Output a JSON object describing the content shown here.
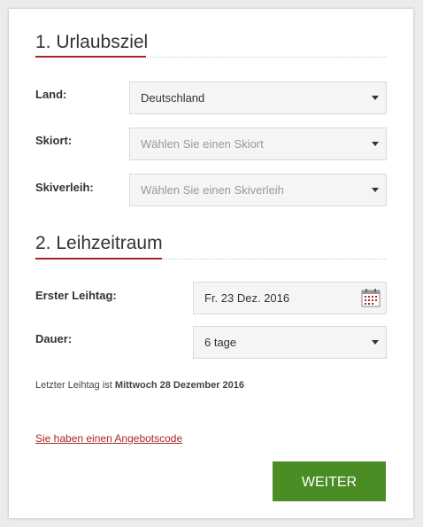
{
  "section1": {
    "title": "1. Urlaubsziel",
    "fields": [
      {
        "label": "Land:",
        "value": "Deutschland",
        "is_placeholder": false
      },
      {
        "label": "Skiort:",
        "value": "Wählen Sie einen Skiort",
        "is_placeholder": true
      },
      {
        "label": "Skiverleih:",
        "value": "Wählen Sie einen Skiverleih",
        "is_placeholder": true
      }
    ]
  },
  "section2": {
    "title": "2. Leihzeitraum",
    "start": {
      "label": "Erster Leihtag:",
      "value": "Fr. 23 Dez. 2016",
      "icon": "calendar-icon"
    },
    "duration": {
      "label": "Dauer:",
      "value": "6 tage"
    },
    "info_prefix": "Letzter Leihtag ist",
    "info_date": "Mittwoch 28 Dezember 2016"
  },
  "promo_link": "Sie haben einen Angebotscode",
  "submit_label": "WEITER",
  "colors": {
    "accent": "#a8262a",
    "button": "#4a8d24",
    "field_bg": "#f5f5f5"
  }
}
